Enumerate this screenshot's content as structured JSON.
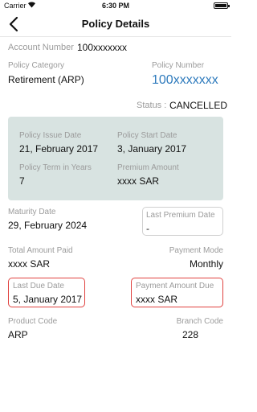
{
  "status_bar": {
    "carrier": "Carrier",
    "time": "6:30 PM"
  },
  "nav": {
    "title": "Policy Details"
  },
  "account": {
    "label": "Account Number",
    "value": "100xxxxxxx"
  },
  "policy_category": {
    "label": "Policy Category",
    "value": "Retirement (ARP)"
  },
  "policy_number": {
    "label": "Policy Number",
    "value": "100xxxxxxx"
  },
  "status": {
    "label": "Status :",
    "value": "CANCELLED"
  },
  "card": {
    "issue_date": {
      "label": "Policy Issue  Date",
      "value": "21, February 2017"
    },
    "start_date": {
      "label": "Policy Start Date",
      "value": "3, January 2017"
    },
    "term": {
      "label": "Policy Term in Years",
      "value": "7"
    },
    "premium": {
      "label": "Premium Amount",
      "value": "xxxx SAR"
    }
  },
  "maturity": {
    "label": "Maturity Date",
    "value": "29, February 2024"
  },
  "last_premium": {
    "label": "Last Premium Date",
    "value": "-"
  },
  "total_paid": {
    "label": "Total Amount Paid",
    "value": "xxxx SAR"
  },
  "payment_mode": {
    "label": "Payment Mode",
    "value": "Monthly"
  },
  "last_due": {
    "label": "Last Due Date",
    "value": "5, January 2017"
  },
  "payment_due": {
    "label": "Payment Amount Due",
    "value": "xxxx SAR"
  },
  "product_code": {
    "label": "Product Code",
    "value": "ARP"
  },
  "branch_code": {
    "label": "Branch Code",
    "value": "228"
  },
  "colors": {
    "accent_blue": "#2f7bbd",
    "card_bg": "#d8e3e1",
    "alert_red": "#e0423f"
  },
  "icons": {
    "back": "chevron-left-icon",
    "wifi": "wifi-icon",
    "battery": "battery-icon"
  }
}
